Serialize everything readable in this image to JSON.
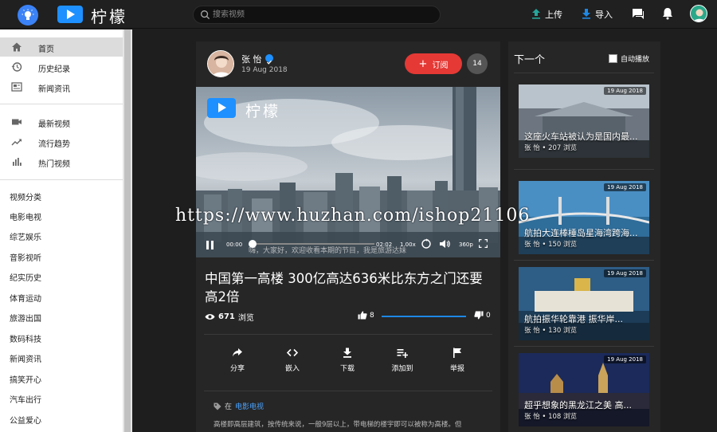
{
  "header": {
    "logo_text": "柠檬",
    "search_placeholder": "搜索视频",
    "upload_label": "上传",
    "import_label": "导入"
  },
  "sidebar": {
    "main_items": [
      {
        "label": "首页",
        "icon": "home-icon"
      },
      {
        "label": "历史纪录",
        "icon": "history-icon"
      },
      {
        "label": "新闻资讯",
        "icon": "news-icon"
      }
    ],
    "secondary_items": [
      {
        "label": "最新视频",
        "icon": "video-camera-icon"
      },
      {
        "label": "流行趋势",
        "icon": "trending-icon"
      },
      {
        "label": "热门视频",
        "icon": "bar-chart-icon"
      }
    ],
    "categories": [
      "视频分类",
      "电影电视",
      "综艺娱乐",
      "音影视听",
      "纪实历史",
      "体育运动",
      "旅游出国",
      "数码科技",
      "新闻资讯",
      "搞笑开心",
      "汽车出行",
      "公益爱心"
    ]
  },
  "video": {
    "channel_name": "张 怡",
    "date": "19 Aug 2018",
    "subscribe_label": "订阅",
    "subscriber_count": "14",
    "player_brand": "柠檬",
    "subtitle": "嗨，大家好，欢迎收看本期的节目，我是旅游达妹",
    "time_current": "00:00",
    "time_total": "02:02",
    "speed": "1.00x",
    "quality": "360p",
    "progress": 0,
    "title": "中国第一高楼 300亿高达636米比东方之门还要高2倍",
    "views": "671",
    "views_label": "浏览",
    "likes": "8",
    "dislikes": "0",
    "actions": [
      {
        "label": "分享",
        "icon": "share-icon"
      },
      {
        "label": "嵌入",
        "icon": "code-icon"
      },
      {
        "label": "下载",
        "icon": "download-icon"
      },
      {
        "label": "添加到",
        "icon": "playlist-add-icon"
      },
      {
        "label": "举报",
        "icon": "flag-icon"
      }
    ],
    "category_prefix": "在",
    "category": "电影电视",
    "description": "高楼即高层建筑，按传统来说，一般9层以上，带电梯的楼宇即可以被称为高楼。但"
  },
  "next": {
    "label": "下一个",
    "autoplay_label": "自动播放",
    "items": [
      {
        "date": "19 Aug 2018",
        "title": "这座火车站被认为是国内最...",
        "meta": "张 怡 • 207 浏览"
      },
      {
        "date": "19 Aug 2018",
        "title": "航拍大连棒棰岛星海湾跨海...",
        "meta": "张 怡 • 150 浏览"
      },
      {
        "date": "19 Aug 2018",
        "title": "航拍振华轮靠港 振华岸...",
        "meta": "张 怡 • 130 浏览"
      },
      {
        "date": "19 Aug 2018",
        "title": "超乎想象的黑龙江之美 高...",
        "meta": "张 怡 • 108 浏览"
      }
    ]
  },
  "watermark": "https://www.huzhan.com/ishop21106"
}
